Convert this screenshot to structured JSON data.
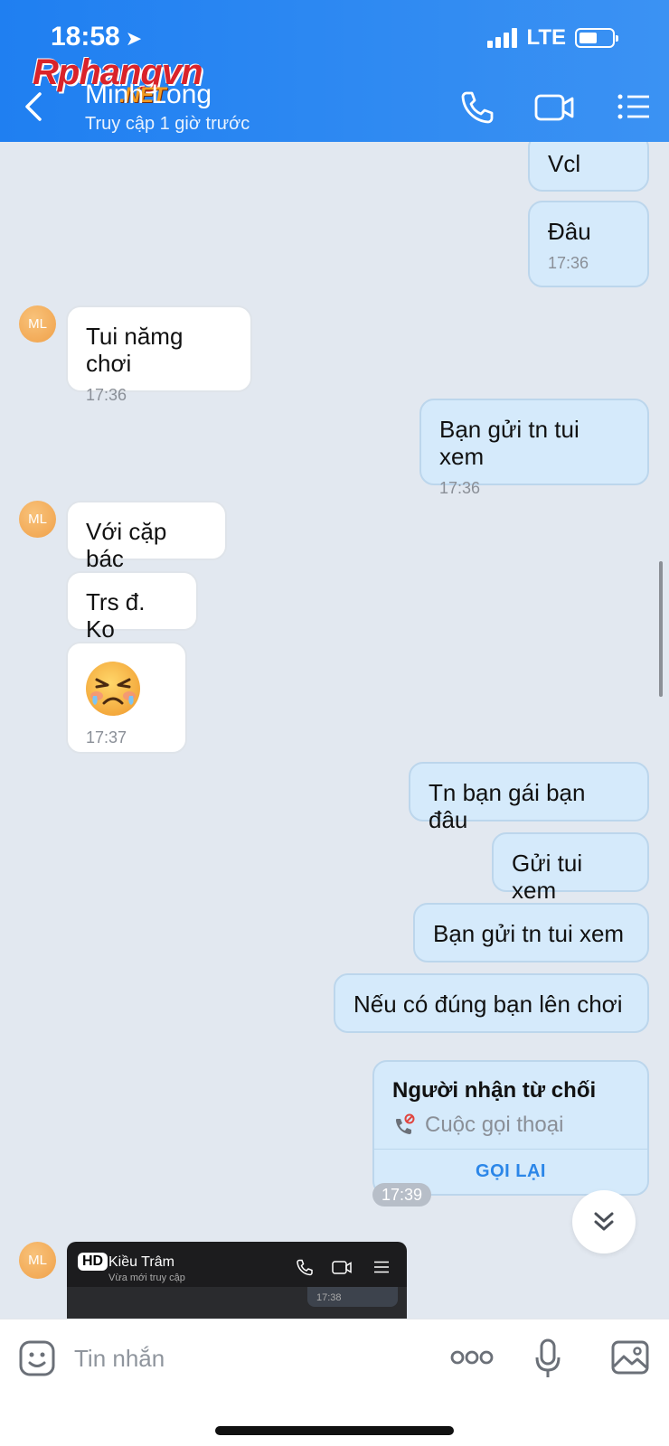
{
  "status_bar": {
    "time": "18:58",
    "network": "LTE"
  },
  "watermark": {
    "brand": "Rphangvn",
    "suffix": ".NET"
  },
  "header": {
    "contact_name": "Minh Long",
    "last_seen": "Truy cập 1 giờ trước",
    "icons": [
      "back-chevron-icon",
      "phone-icon",
      "video-call-icon",
      "list-menu-icon"
    ]
  },
  "messages": [
    {
      "side": "out",
      "text": "Vcl"
    },
    {
      "side": "out",
      "text": "Đâu",
      "time": "17:36"
    },
    {
      "side": "in",
      "avatar": "ML",
      "text": "Tui nămg chơi",
      "time": "17:36"
    },
    {
      "side": "out",
      "text": "Bạn gửi tn tui xem",
      "time": "17:36"
    },
    {
      "side": "in",
      "avatar": "ML",
      "text": "Với cặp bác"
    },
    {
      "side": "in",
      "text": "Trs đ. Ko"
    },
    {
      "side": "in",
      "sticker": "crying-angry-emoji",
      "time": "17:37"
    },
    {
      "side": "out",
      "text": "Tn bạn gái bạn đâu"
    },
    {
      "side": "out",
      "text": "Gửi tui xem"
    },
    {
      "side": "out",
      "text": "Bạn gửi tn tui xem"
    },
    {
      "side": "out",
      "text": "Nếu có đúng bạn lên chơi"
    }
  ],
  "call_card": {
    "title": "Người nhận từ chối",
    "subtitle": "Cuộc gọi thoại",
    "action": "GỌI LẠI",
    "time": "17:39"
  },
  "screenshot_preview": {
    "avatar": "ML",
    "badge": "HD",
    "name": "Kiều Trâm",
    "status": "Vừa mới truy cập",
    "time": "17:38"
  },
  "input": {
    "placeholder": "Tin nhắn"
  },
  "colors": {
    "header": "#1f7ff1",
    "outgoing_bubble": "#d5eafb",
    "incoming_bubble": "#ffffff",
    "accent": "#2b86e8"
  }
}
